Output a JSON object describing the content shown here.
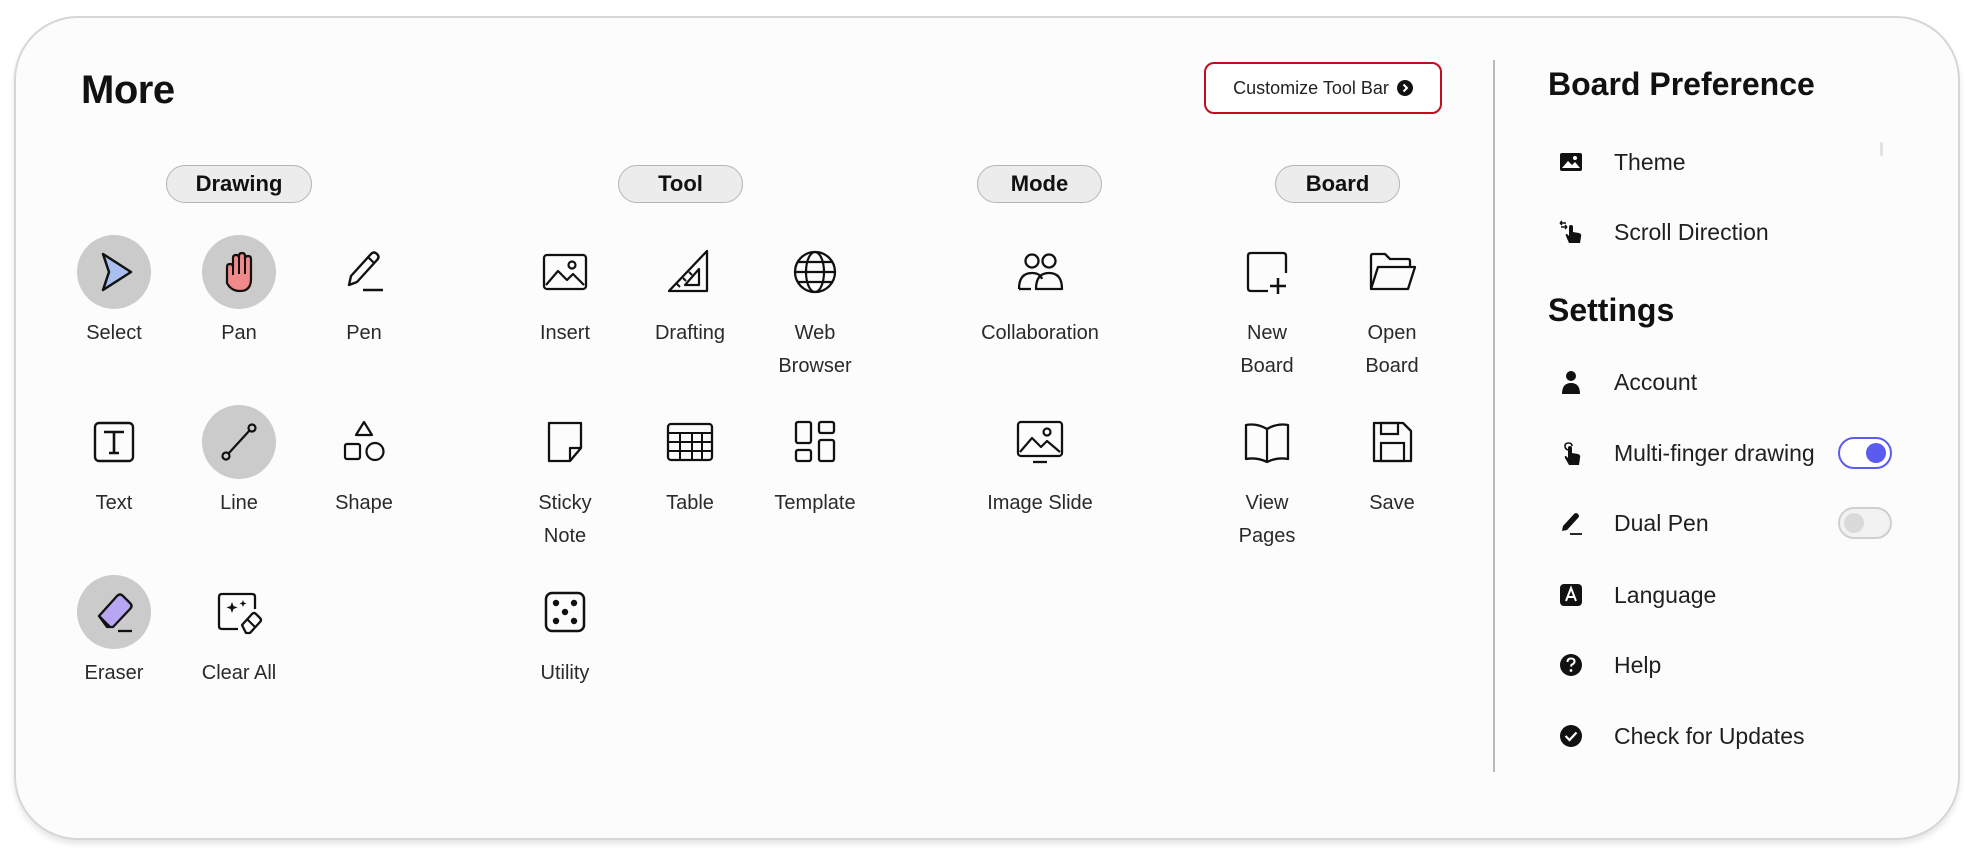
{
  "header": {
    "title": "More",
    "customize_label": "Customize Tool Bar"
  },
  "groups": {
    "drawing": "Drawing",
    "tool": "Tool",
    "mode": "Mode",
    "board": "Board"
  },
  "drawing": {
    "select": "Select",
    "pan": "Pan",
    "pen": "Pen",
    "text": "Text",
    "line": "Line",
    "shape": "Shape",
    "eraser": "Eraser",
    "clear_all": "Clear All"
  },
  "tool": {
    "insert": "Insert",
    "drafting": "Drafting",
    "web_browser": "Web\nBrowser",
    "sticky_note": "Sticky\nNote",
    "table": "Table",
    "template": "Template",
    "utility": "Utility"
  },
  "mode": {
    "collaboration": "Collaboration",
    "image_slide": "Image Slide"
  },
  "board": {
    "new_board": "New\nBoard",
    "open_board": "Open\nBoard",
    "view_pages": "View\nPages",
    "save": "Save"
  },
  "sidebar": {
    "board_pref_title": "Board Preference",
    "theme": "Theme",
    "scroll_direction": "Scroll Direction",
    "settings_title": "Settings",
    "account": "Account",
    "multi_finger": "Multi-finger drawing",
    "multi_finger_on": true,
    "dual_pen": "Dual Pen",
    "dual_pen_on": false,
    "language": "Language",
    "help": "Help",
    "check_updates": "Check for Updates"
  },
  "colors": {
    "accent": "#5b5bf0",
    "customize_border": "#c20d1f",
    "select_fill": "#a9bff0",
    "pan_fill": "#f08a8a",
    "eraser_fill": "#b7a6f2"
  }
}
